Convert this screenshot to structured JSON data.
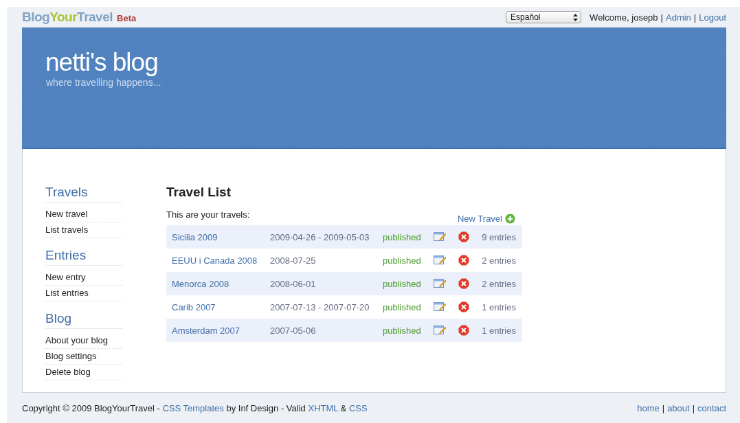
{
  "logo": {
    "parts": [
      "Blog",
      "Your",
      "Travel"
    ],
    "badge": "Beta"
  },
  "top_bar": {
    "language": "Español",
    "welcome": "Welcome, josepb",
    "links": [
      {
        "kind": "separator",
        "text": "|"
      },
      {
        "kind": "link",
        "text": "Admin"
      },
      {
        "kind": "separator",
        "text": "|"
      },
      {
        "kind": "link",
        "text": "Logout"
      }
    ]
  },
  "banner": {
    "title": "netti's blog",
    "tagline": "where travelling happens..."
  },
  "sidebar": [
    {
      "heading": "Travels",
      "items": [
        "New travel",
        "List travels"
      ]
    },
    {
      "heading": "Entries",
      "items": [
        "New entry",
        "List entries"
      ]
    },
    {
      "heading": "Blog",
      "items": [
        "About your blog",
        "Blog settings",
        "Delete blog"
      ]
    }
  ],
  "main": {
    "title": "Travel List",
    "intro": "This are your travels:",
    "new_button": "New Travel",
    "rows": [
      {
        "name": "Sicilia 2009",
        "dates": "2009-04-26 - 2009-05-03",
        "status": "published",
        "entries": "9 entries"
      },
      {
        "name": "EEUU i Canada 2008",
        "dates": "2008-07-25",
        "status": "published",
        "entries": "2 entries"
      },
      {
        "name": "Menorca 2008",
        "dates": "2008-06-01",
        "status": "published",
        "entries": "2 entries"
      },
      {
        "name": "Carib 2007",
        "dates": "2007-07-13 - 2007-07-20",
        "status": "published",
        "entries": "1 entries"
      },
      {
        "name": "Amsterdam 2007",
        "dates": "2007-05-06",
        "status": "published",
        "entries": "1 entries"
      }
    ]
  },
  "footer": {
    "copyright": [
      {
        "kind": "text",
        "text": "Copyright © 2009 BlogYourTravel - "
      },
      {
        "kind": "link",
        "text": "CSS Templates"
      },
      {
        "kind": "text",
        "text": " by Inf Design - Valid "
      },
      {
        "kind": "link",
        "text": "XHTML"
      },
      {
        "kind": "text",
        "text": " & "
      },
      {
        "kind": "link",
        "text": "CSS"
      }
    ],
    "links": [
      {
        "kind": "link",
        "text": "home"
      },
      {
        "kind": "separator",
        "text": "|"
      },
      {
        "kind": "link",
        "text": "about"
      },
      {
        "kind": "separator",
        "text": "|"
      },
      {
        "kind": "link",
        "text": "contact"
      }
    ]
  }
}
